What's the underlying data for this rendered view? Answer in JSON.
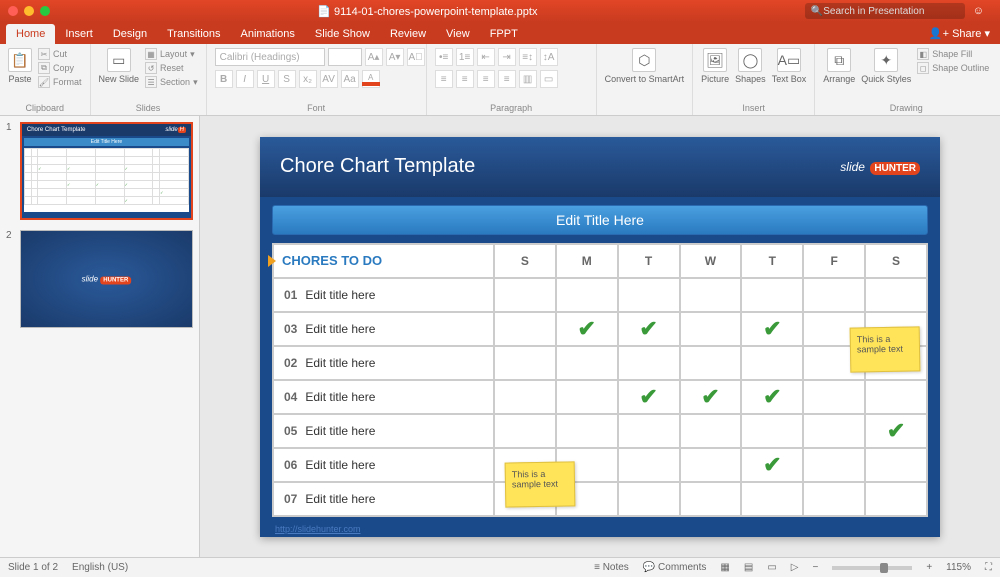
{
  "titlebar": {
    "filename": "9114-01-chores-powerpoint-template.pptx",
    "search_placeholder": "Search in Presentation",
    "share": "Share"
  },
  "ribbon": {
    "tabs": [
      "Home",
      "Insert",
      "Design",
      "Transitions",
      "Animations",
      "Slide Show",
      "Review",
      "View",
      "FPPT"
    ],
    "active_tab": "Home",
    "clipboard": {
      "paste": "Paste",
      "cut": "Cut",
      "copy": "Copy",
      "format": "Format",
      "label": "Clipboard"
    },
    "slides": {
      "new_slide": "New Slide",
      "layout": "Layout",
      "reset": "Reset",
      "section": "Section",
      "label": "Slides"
    },
    "font": {
      "family": "Calibri (Headings)",
      "size": "",
      "label": "Font"
    },
    "paragraph": {
      "label": "Paragraph",
      "convert": "Convert to SmartArt"
    },
    "insert": {
      "picture": "Picture",
      "shapes": "Shapes",
      "textbox": "Text Box",
      "label": "Insert"
    },
    "drawing": {
      "arrange": "Arrange",
      "quick": "Quick Styles",
      "fill": "Shape Fill",
      "outline": "Shape Outline",
      "label": "Drawing"
    }
  },
  "thumbs": {
    "count": 2,
    "active": 1
  },
  "slide": {
    "title": "Chore Chart Template",
    "logo_a": "slide",
    "logo_b": "HUNTER",
    "subtitle": "Edit Title Here",
    "chores_header": "CHORES TO DO",
    "days": [
      "S",
      "M",
      "T",
      "W",
      "T",
      "F",
      "S"
    ],
    "rows": [
      {
        "num": "01",
        "text": "Edit title here",
        "checks": []
      },
      {
        "num": "03",
        "text": "Edit title here",
        "checks": [
          1,
          2,
          4
        ]
      },
      {
        "num": "02",
        "text": "Edit title here",
        "checks": []
      },
      {
        "num": "04",
        "text": "Edit title here",
        "checks": [
          2,
          3,
          4
        ]
      },
      {
        "num": "05",
        "text": "Edit title here",
        "checks": [
          6
        ]
      },
      {
        "num": "06",
        "text": "Edit title here",
        "checks": [
          4
        ]
      },
      {
        "num": "07",
        "text": "Edit title here",
        "checks": []
      }
    ],
    "sticky1": "This is a sample text",
    "sticky2": "This is a sample text",
    "link": "http://slidehunter.com"
  },
  "status": {
    "slide_of": "Slide 1 of 2",
    "lang": "English (US)",
    "notes": "Notes",
    "comments": "Comments",
    "zoom": "115%"
  }
}
